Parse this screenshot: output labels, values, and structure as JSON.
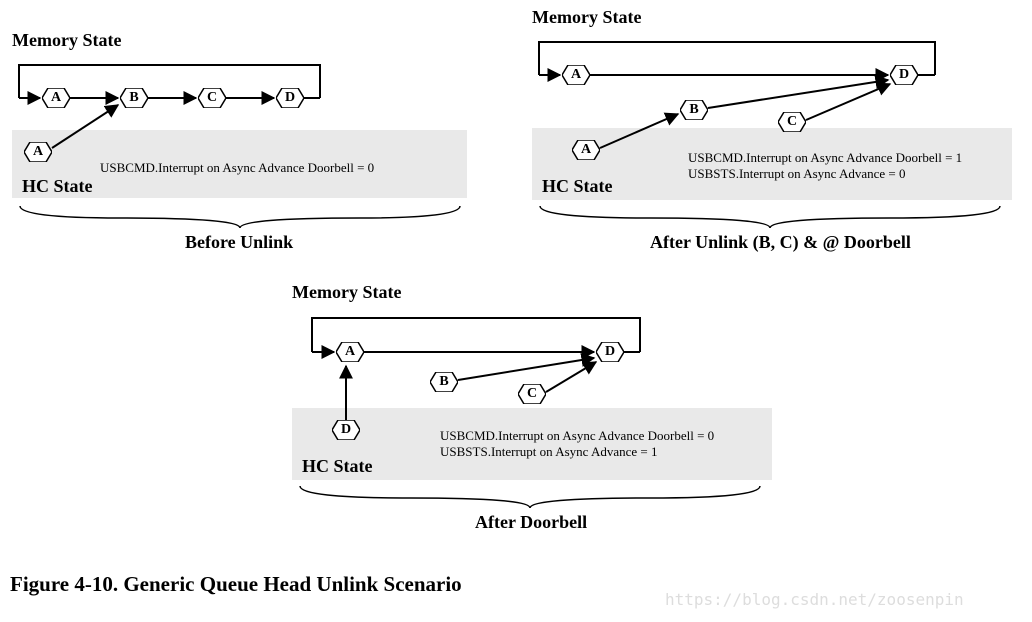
{
  "panel1": {
    "memory_state": "Memory State",
    "hc_state": "HC State",
    "nodes": {
      "A": "A",
      "B": "B",
      "C": "C",
      "D": "D"
    },
    "hc_node": "A",
    "text1": "USBCMD.Interrupt on Async Advance Doorbell = 0",
    "caption": "Before Unlink"
  },
  "panel2": {
    "memory_state": "Memory State",
    "hc_state": "HC State",
    "nodes": {
      "A": "A",
      "B": "B",
      "C": "C",
      "D": "D"
    },
    "hc_node": "A",
    "text1": "USBCMD.Interrupt on Async Advance Doorbell = 1",
    "text2": "USBSTS.Interrupt on Async Advance = 0",
    "caption": "After Unlink (B, C) & @ Doorbell"
  },
  "panel3": {
    "memory_state": "Memory State",
    "hc_state": "HC State",
    "nodes": {
      "A": "A",
      "B": "B",
      "C": "C",
      "D": "D"
    },
    "hc_node": "D",
    "text1": "USBCMD.Interrupt on Async Advance Doorbell = 0",
    "text2": "USBSTS.Interrupt on Async Advance = 1",
    "caption": "After Doorbell"
  },
  "figure_caption": "Figure 4-10. Generic Queue Head Unlink Scenario",
  "watermark": "https://blog.csdn.net/zoosenpin"
}
